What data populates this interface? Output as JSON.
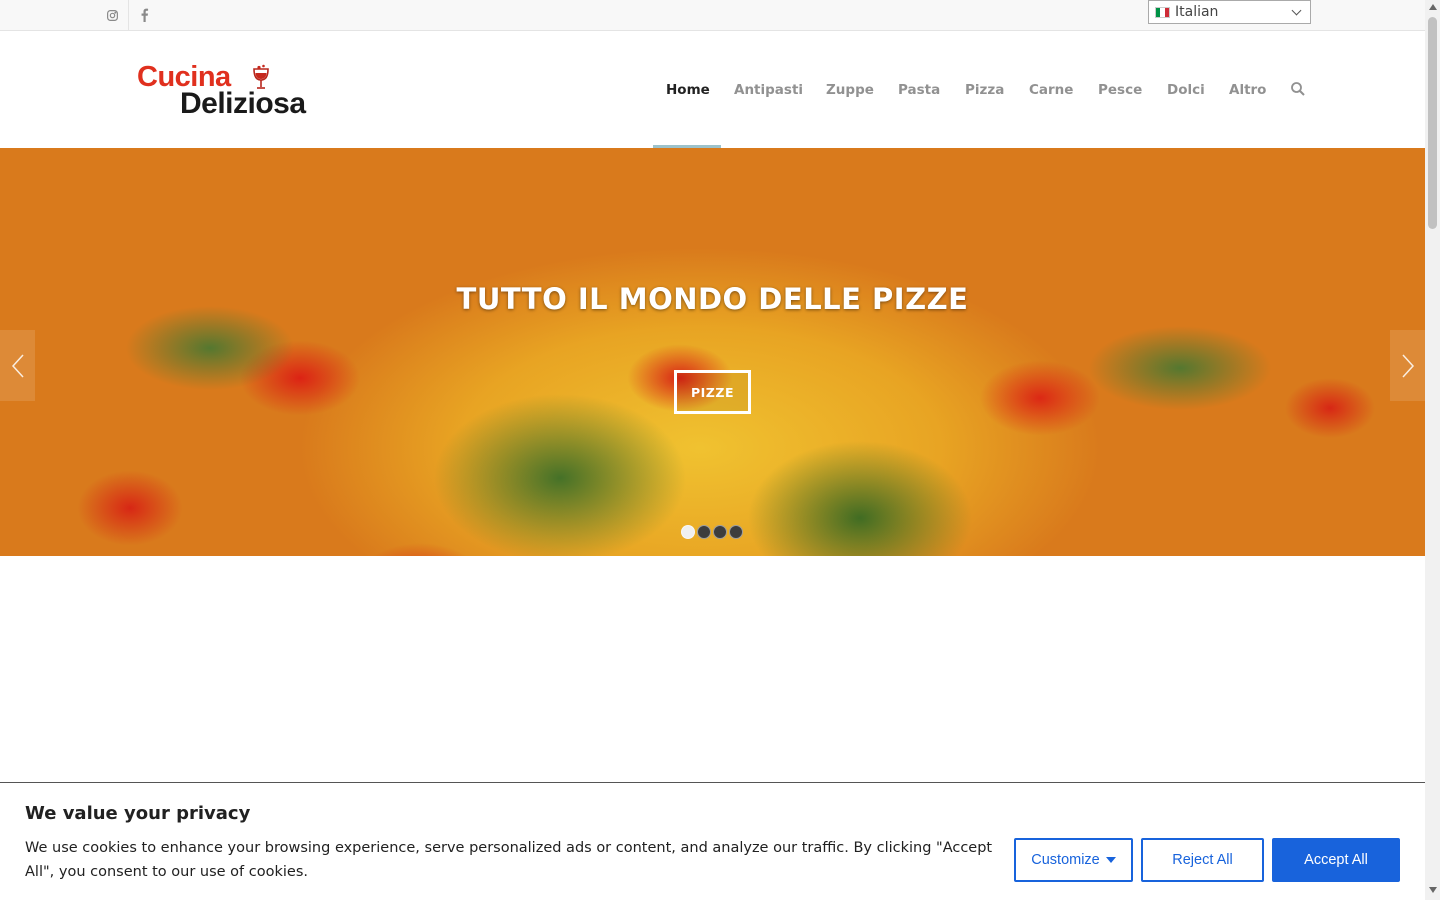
{
  "topbar": {
    "social": [
      {
        "icon": "instagram-icon"
      },
      {
        "icon": "facebook-icon"
      }
    ],
    "language": {
      "selected": "Italian",
      "flag": "italy-flag",
      "flag_colors": [
        "#009246",
        "#ffffff",
        "#ce2b37"
      ]
    }
  },
  "header": {
    "logo": {
      "line1": "Cucina",
      "line2": "Deliziosa",
      "colors": {
        "line1": "#e0301e",
        "line2": "#1a1a1a"
      }
    },
    "nav": {
      "items": [
        {
          "label": "Home",
          "active": true
        },
        {
          "label": "Antipasti",
          "active": false
        },
        {
          "label": "Zuppe",
          "active": false
        },
        {
          "label": "Pasta",
          "active": false
        },
        {
          "label": "Pizza",
          "active": false
        },
        {
          "label": "Carne",
          "active": false
        },
        {
          "label": "Pesce",
          "active": false
        },
        {
          "label": "Dolci",
          "active": false
        },
        {
          "label": "Altro",
          "active": false
        }
      ],
      "search_icon": "search-icon",
      "active_indicator_color": "#9cc2cb"
    }
  },
  "hero": {
    "title": "TUTTO IL MONDO DELLE PIZZE",
    "button_label": "PIZZE",
    "prev_icon": "chevron-left-icon",
    "next_icon": "chevron-right-icon",
    "slides": 4,
    "active_slide": 1
  },
  "cookie_banner": {
    "title": "We value your privacy",
    "text": "We use cookies to enhance your browsing experience, serve personalized ads or content, and analyze our traffic. By clicking \"Accept All\", you consent to our use of cookies.",
    "customize_label": "Customize",
    "reject_label": "Reject All",
    "accept_label": "Accept All",
    "accent": "#1863dc"
  }
}
